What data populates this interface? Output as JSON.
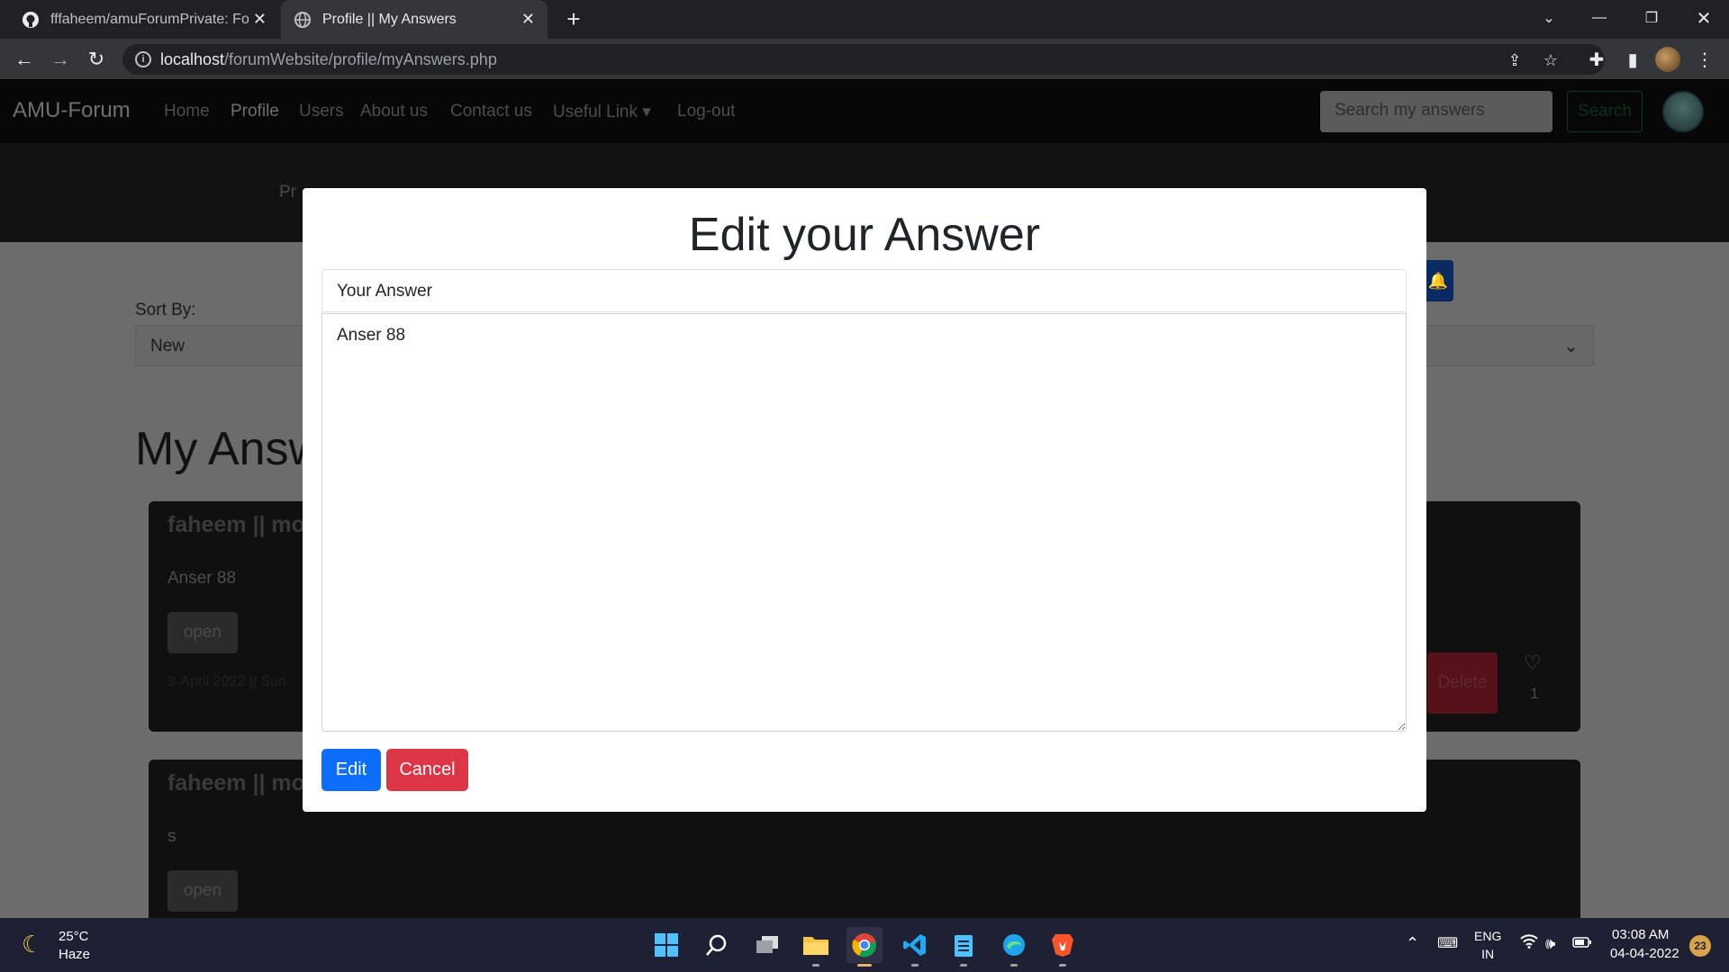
{
  "browser": {
    "tabs": [
      {
        "title": "fffaheem/amuForumPrivate: Forum",
        "icon": "github-icon",
        "active": false
      },
      {
        "title": "Profile || My Answers",
        "icon": "globe-icon",
        "active": true
      }
    ],
    "url_host": "localhost",
    "url_path": "/forumWebsite/profile/myAnswers.php"
  },
  "site": {
    "brand": "AMU-Forum",
    "nav": [
      "Home",
      "Profile",
      "Users",
      "About us",
      "Contact us",
      "Useful Link",
      "Log-out"
    ],
    "search_placeholder": "Search my answers",
    "search_button": "Search",
    "hero_text": "Pr",
    "sort_label": "Sort By:",
    "sort_value": "New",
    "heading": "My Answ",
    "cards": [
      {
        "title": "faheem || mo",
        "body": "Anser 88",
        "open": "open",
        "date": "3-April 2022 || Sun",
        "delete": "Delete",
        "likes": "1"
      },
      {
        "title": "faheem || mo",
        "body": "s",
        "open": "open"
      }
    ]
  },
  "modal": {
    "title": "Edit your Answer",
    "answer_label": "Your Answer",
    "answer_text": "Anser 88",
    "edit_button": "Edit",
    "cancel_button": "Cancel"
  },
  "taskbar": {
    "weather_temp": "25°C",
    "weather_cond": "Haze",
    "lang_line1": "ENG",
    "lang_line2": "IN",
    "time": "03:08 AM",
    "date": "04-04-2022",
    "notifications": "23"
  },
  "colors": {
    "primary": "#0d6efd",
    "danger": "#dc3545",
    "taskbar": "#1e2033"
  }
}
